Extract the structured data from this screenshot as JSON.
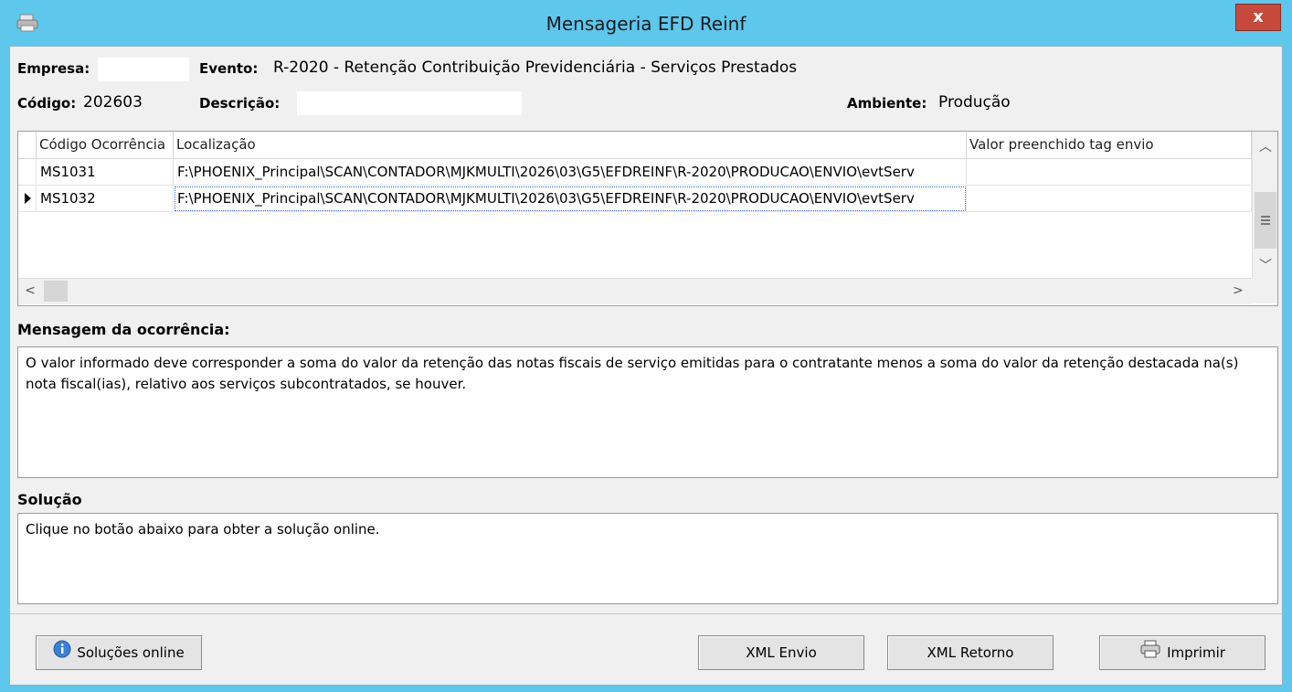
{
  "window": {
    "title": "Mensageria EFD Reinf",
    "close_label": "x"
  },
  "header": {
    "empresa_label": "Empresa:",
    "empresa_value": "",
    "evento_label": "Evento:",
    "evento_value": "R-2020 - Retenção Contribuição Previdenciária - Serviços Prestados",
    "codigo_label": "Código:",
    "codigo_value": "202603",
    "descricao_label": "Descrição:",
    "descricao_value": "",
    "ambiente_label": "Ambiente:",
    "ambiente_value": "Produção"
  },
  "grid": {
    "columns": [
      "Código Ocorrência",
      "Localização",
      "Valor preenchido tag envio"
    ],
    "rows": [
      {
        "codigo": "MS1031",
        "localizacao": "F:\\PHOENIX_Principal\\SCAN\\CONTADOR\\MJKMULTI\\2026\\03\\G5\\EFDREINF\\R-2020\\PRODUCAO\\ENVIO\\evtServ",
        "valor": ""
      },
      {
        "codigo": "MS1032",
        "localizacao": "F:\\PHOENIX_Principal\\SCAN\\CONTADOR\\MJKMULTI\\2026\\03\\G5\\EFDREINF\\R-2020\\PRODUCAO\\ENVIO\\evtServ",
        "valor": ""
      }
    ],
    "selected_row": 1
  },
  "mensagem": {
    "label": "Mensagem da ocorrência:",
    "text": "O valor informado deve corresponder a soma do valor da retenção das notas fiscais de serviço emitidas para o contratante menos a soma do valor da retenção destacada na(s) nota fiscal(ias), relativo aos serviços subcontratados, se houver."
  },
  "solucao": {
    "label": "Solução",
    "text": "Clique no botão abaixo para obter a solução online."
  },
  "buttons": {
    "solucoes_online": "Soluções online",
    "xml_envio": "XML Envio",
    "xml_retorno": "XML Retorno",
    "imprimir": "Imprimir"
  },
  "colors": {
    "frame": "#5dc7ec",
    "close": "#c7493b",
    "client": "#f0f0f0"
  }
}
